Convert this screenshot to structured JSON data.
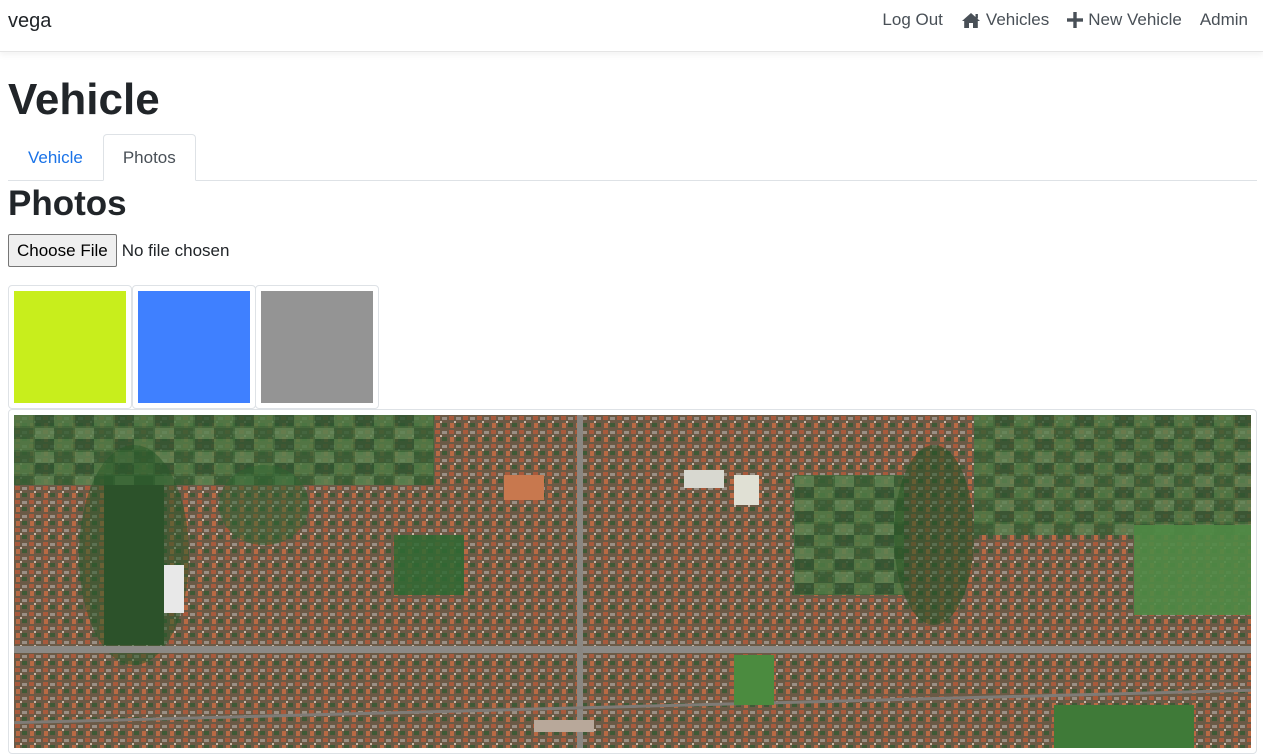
{
  "app": {
    "brand": "vega"
  },
  "nav": {
    "logout": "Log Out",
    "vehicles": "Vehicles",
    "new_vehicle": "New Vehicle",
    "admin": "Admin",
    "icons": {
      "vehicles": "home-icon",
      "new_vehicle": "plus-icon"
    }
  },
  "page": {
    "title": "Vehicle"
  },
  "tabs": [
    {
      "label": "Vehicle",
      "active": false
    },
    {
      "label": "Photos",
      "active": true
    }
  ],
  "photos": {
    "heading": "Photos",
    "file_input": {
      "button_label": "Choose File",
      "status": "No file chosen"
    },
    "thumbnails": [
      {
        "color": "#c8ee1c"
      },
      {
        "color": "#3f80ff"
      },
      {
        "color": "#949494"
      }
    ],
    "large_photo": {
      "kind": "aerial satellite image of a city"
    }
  },
  "colors": {
    "link": "#1a73e8",
    "text": "#212529",
    "border": "#dee2e6"
  }
}
